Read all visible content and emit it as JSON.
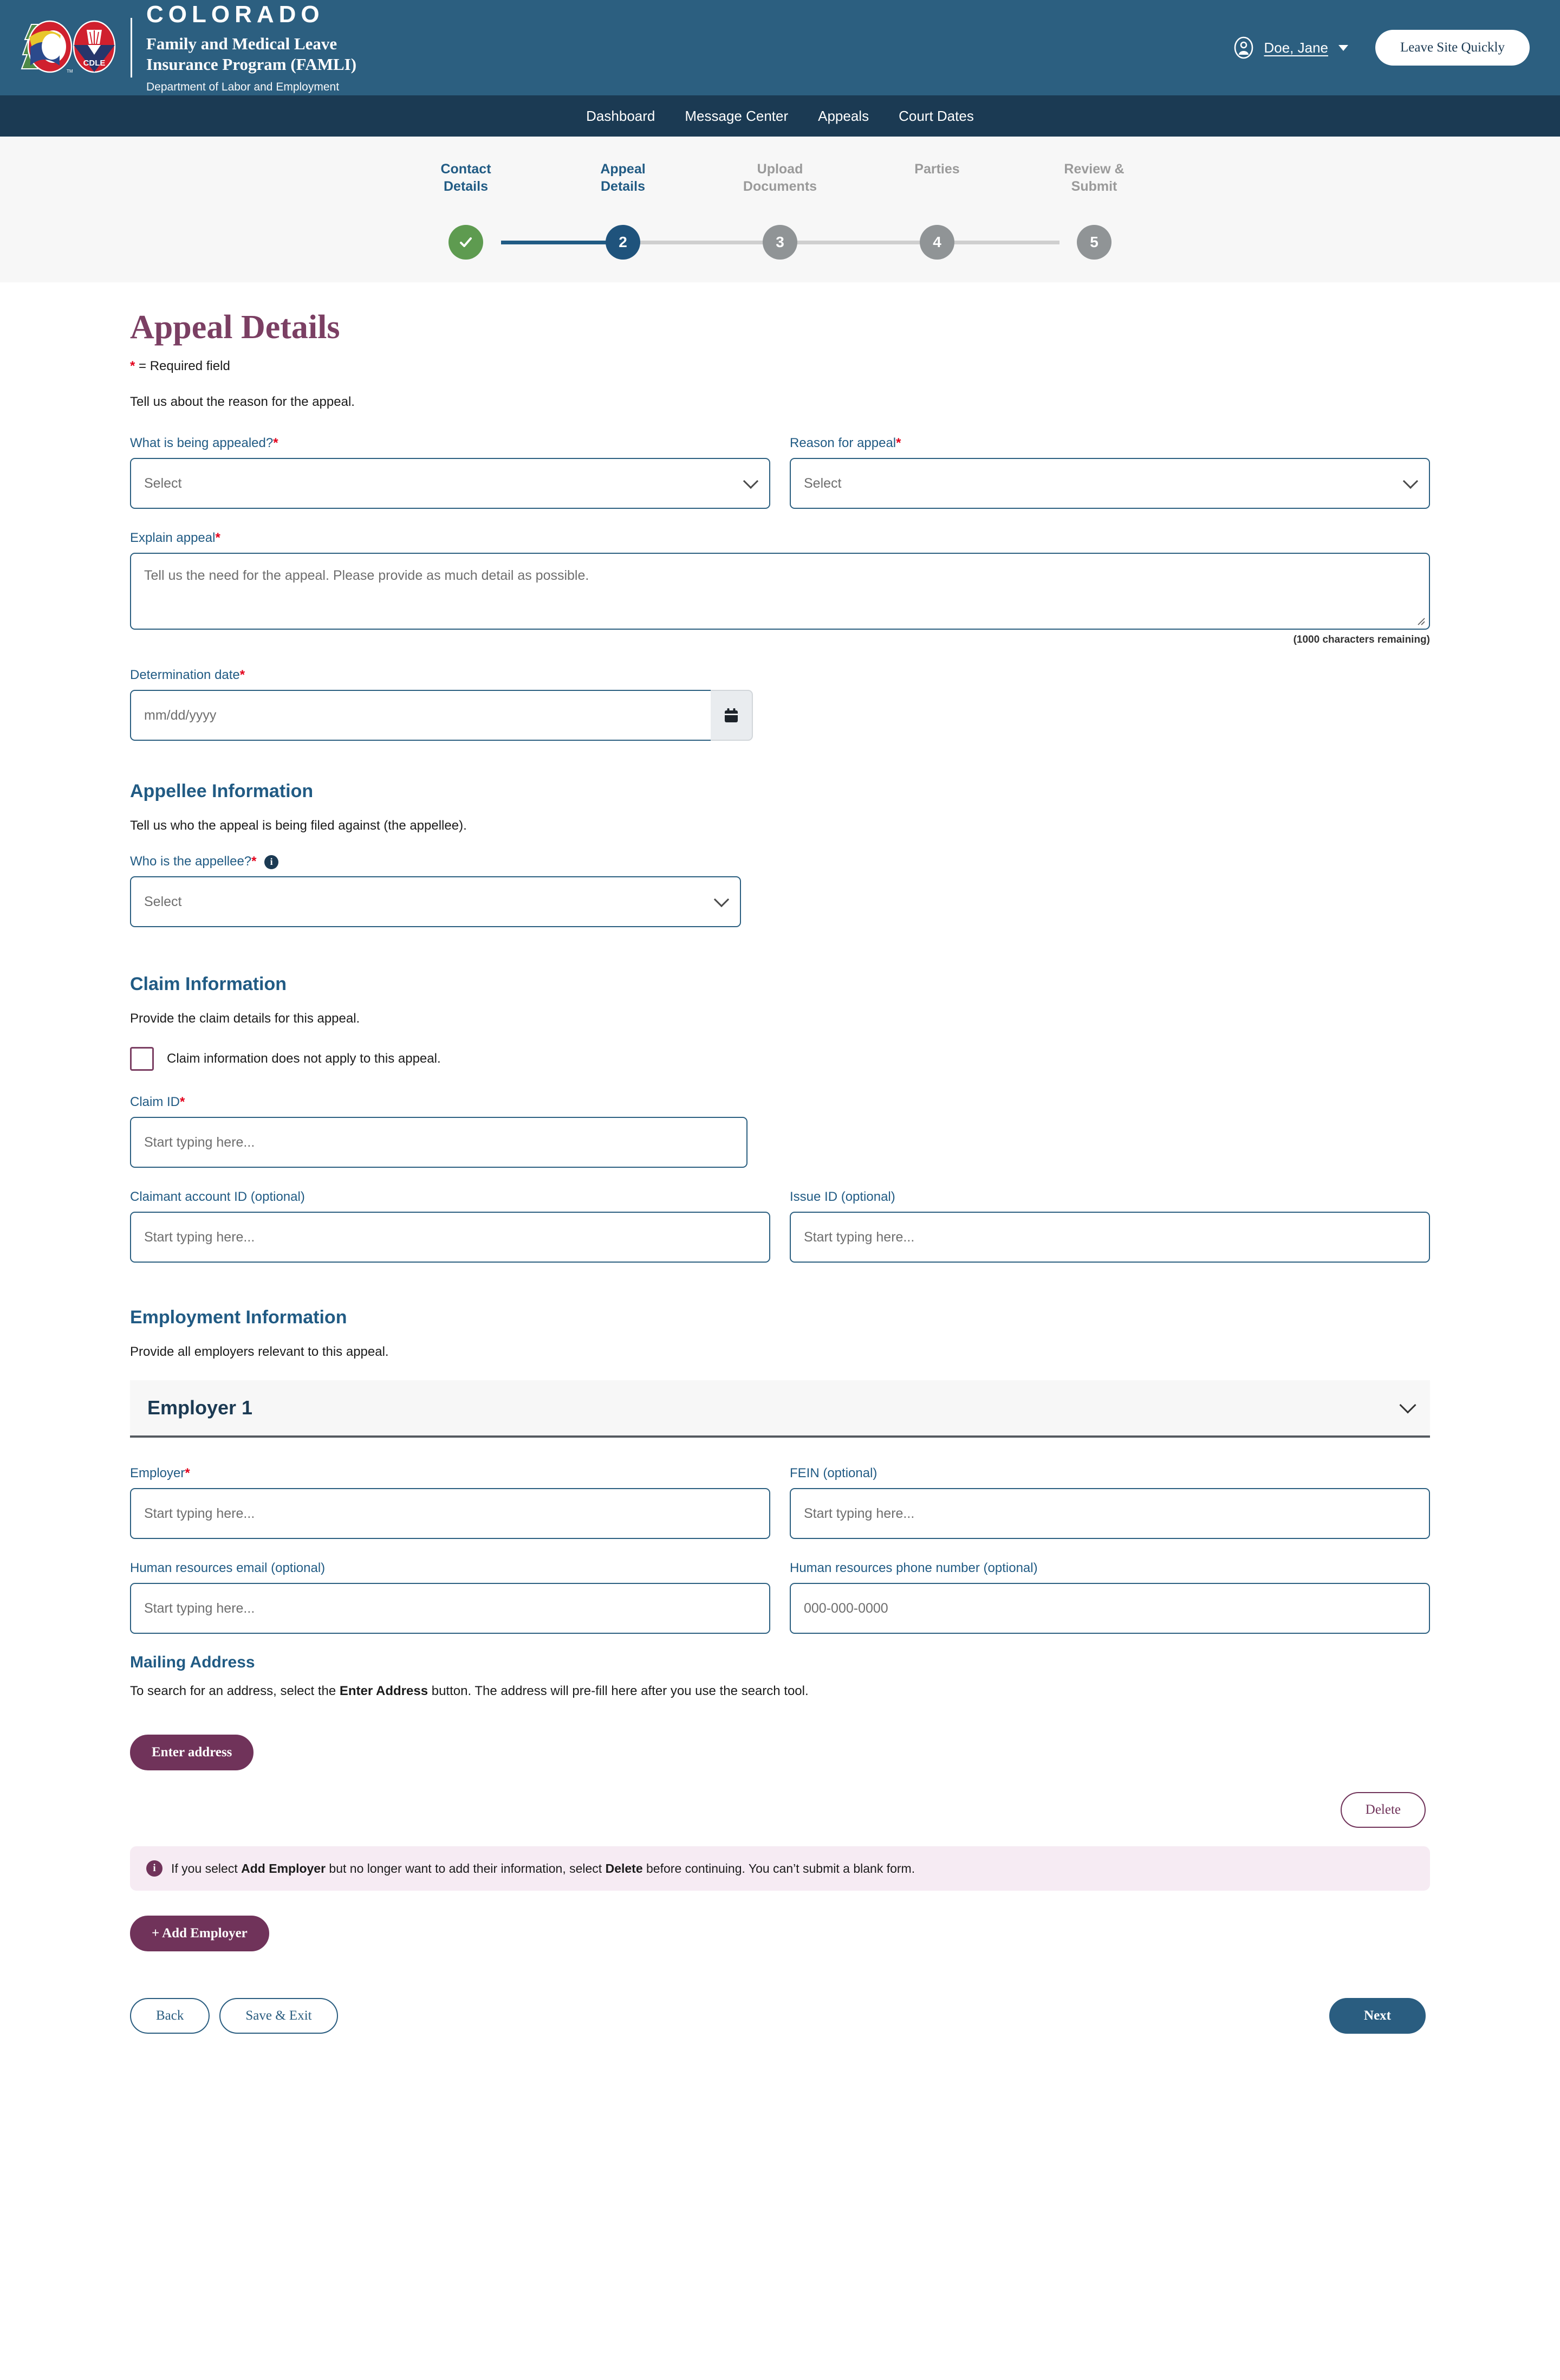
{
  "header": {
    "brand": {
      "state": "COLORADO",
      "program_line1": "Family and Medical Leave",
      "program_line2": "Insurance Program (FAMLI)",
      "department": "Department of Labor and Employment",
      "logo_mark": "colorado-cdle-logo"
    },
    "user_name": "Doe, Jane",
    "user_icon": "user-circle-icon",
    "caret_icon": "chevron-down-icon",
    "leave_button": "Leave Site Quickly",
    "bg_color": "#2c5f80",
    "nav_bg_color": "#1b3a53"
  },
  "nav": {
    "items": [
      {
        "label": "Dashboard"
      },
      {
        "label": "Message Center"
      },
      {
        "label": "Appeals"
      },
      {
        "label": "Court Dates"
      }
    ]
  },
  "stepper": {
    "steps": [
      {
        "label": "Contact\nDetails",
        "label_line1": "Contact",
        "label_line2": "Details",
        "marker": "✓",
        "state": "done"
      },
      {
        "label": "Appeal Details",
        "label_line1": "Appeal",
        "label_line2": "Details",
        "marker": "2",
        "state": "active"
      },
      {
        "label": "Upload Documents",
        "label_line1": "Upload",
        "label_line2": "Documents",
        "marker": "3",
        "state": "todo"
      },
      {
        "label": "Parties",
        "label_line1": "Parties",
        "label_line2": "",
        "marker": "4",
        "state": "todo"
      },
      {
        "label": "Review & Submit",
        "label_line1": "Review &",
        "label_line2": "Submit",
        "marker": "5",
        "state": "todo"
      }
    ],
    "colors": {
      "done": "#5e9b50",
      "active": "#1f537c",
      "todo": "#909496",
      "connector_filled": "#215b84",
      "connector_empty": "#cfcfcf"
    }
  },
  "page": {
    "title": "Appeal Details",
    "title_color": "#7b3f63",
    "required_note_star": "*",
    "required_note_text": " = Required field",
    "intro": "Tell us about the reason for the appeal."
  },
  "appeal": {
    "what_appealed": {
      "label": "What is being appealed?",
      "required": "*",
      "value": "Select"
    },
    "reason": {
      "label": "Reason for appeal",
      "required": "*",
      "value": "Select"
    },
    "explain": {
      "label": "Explain appeal",
      "required": "*",
      "placeholder": "Tell us the need for the appeal. Please provide as much detail as possible.",
      "char_count": "(1000 characters remaining)"
    },
    "determination_date": {
      "label": "Determination date",
      "required": "*",
      "placeholder": "mm/dd/yyyy",
      "calendar_icon": "calendar-icon"
    }
  },
  "appellee": {
    "title": "Appellee Information",
    "description": "Tell us who the appeal is being filed against (the appellee).",
    "who": {
      "label": "Who is the appellee?",
      "required": "*",
      "info_icon": "info-icon",
      "value": "Select"
    }
  },
  "claim": {
    "title": "Claim Information",
    "description": "Provide the claim details for this appeal.",
    "not_apply_checkbox": {
      "label": "Claim information does not apply to this appeal.",
      "checked": false
    },
    "claim_id": {
      "label": "Claim ID",
      "required": "*",
      "placeholder": "Start typing here..."
    },
    "claimant_account_id": {
      "label": "Claimant account ID (optional)",
      "placeholder": "Start typing here..."
    },
    "issue_id": {
      "label": "Issue ID (optional)",
      "placeholder": "Start typing here..."
    }
  },
  "employment": {
    "title": "Employment Information",
    "description": "Provide all employers relevant to this appeal.",
    "accordion_title": "Employer 1",
    "accordion_icon": "chevron-down-icon",
    "employer": {
      "label": "Employer",
      "required": "*",
      "placeholder": "Start typing here..."
    },
    "fein": {
      "label": "FEIN (optional)",
      "placeholder": "Start typing here..."
    },
    "hr_email": {
      "label": "Human resources email (optional)",
      "placeholder": "Start typing here..."
    },
    "hr_phone": {
      "label": "Human resources phone number (optional)",
      "placeholder": "000-000-0000"
    },
    "mailing_address": {
      "title": "Mailing Address",
      "desc_part1": "To search for an address, select the ",
      "desc_bold": "Enter Address",
      "desc_part2": " button. The address will pre-fill here after you use the search tool.",
      "enter_address_button": "Enter address"
    },
    "delete_button": "Delete",
    "alert": {
      "icon": "info-icon",
      "part1": "If you select ",
      "bold1": "Add Employer",
      "part2": " but no longer want to add their information, select ",
      "bold2": "Delete",
      "part3": " before continuing. You can’t submit a blank form."
    },
    "add_employer_button": "+ Add Employer"
  },
  "footer": {
    "back_button": "Back",
    "save_exit_button": "Save & Exit",
    "next_button": "Next"
  }
}
